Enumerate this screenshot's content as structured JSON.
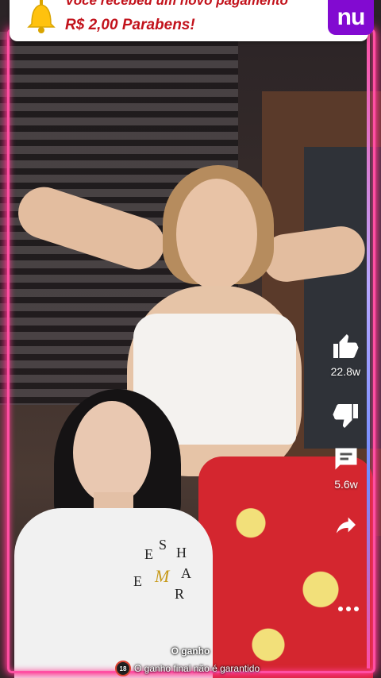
{
  "notification": {
    "line1": "Você recebeu um novo pagamento",
    "line2": "R$ 2,00 Parabens!",
    "brand": "nu",
    "icon": "bell-icon",
    "text_color": "#c2121b",
    "brand_color": "#820ad1"
  },
  "actions": {
    "like_count": "22.8w",
    "comment_count": "5.6w"
  },
  "shirt_logo": {
    "letters": [
      "E",
      "S",
      "H",
      "A",
      "R",
      "E",
      "M"
    ]
  },
  "captions": {
    "line1": "O ganho",
    "age_rating": "18",
    "line2": "O ganho final não é garantido"
  },
  "colors": {
    "neon": "#ff4fa3",
    "like": "#ffffff"
  }
}
